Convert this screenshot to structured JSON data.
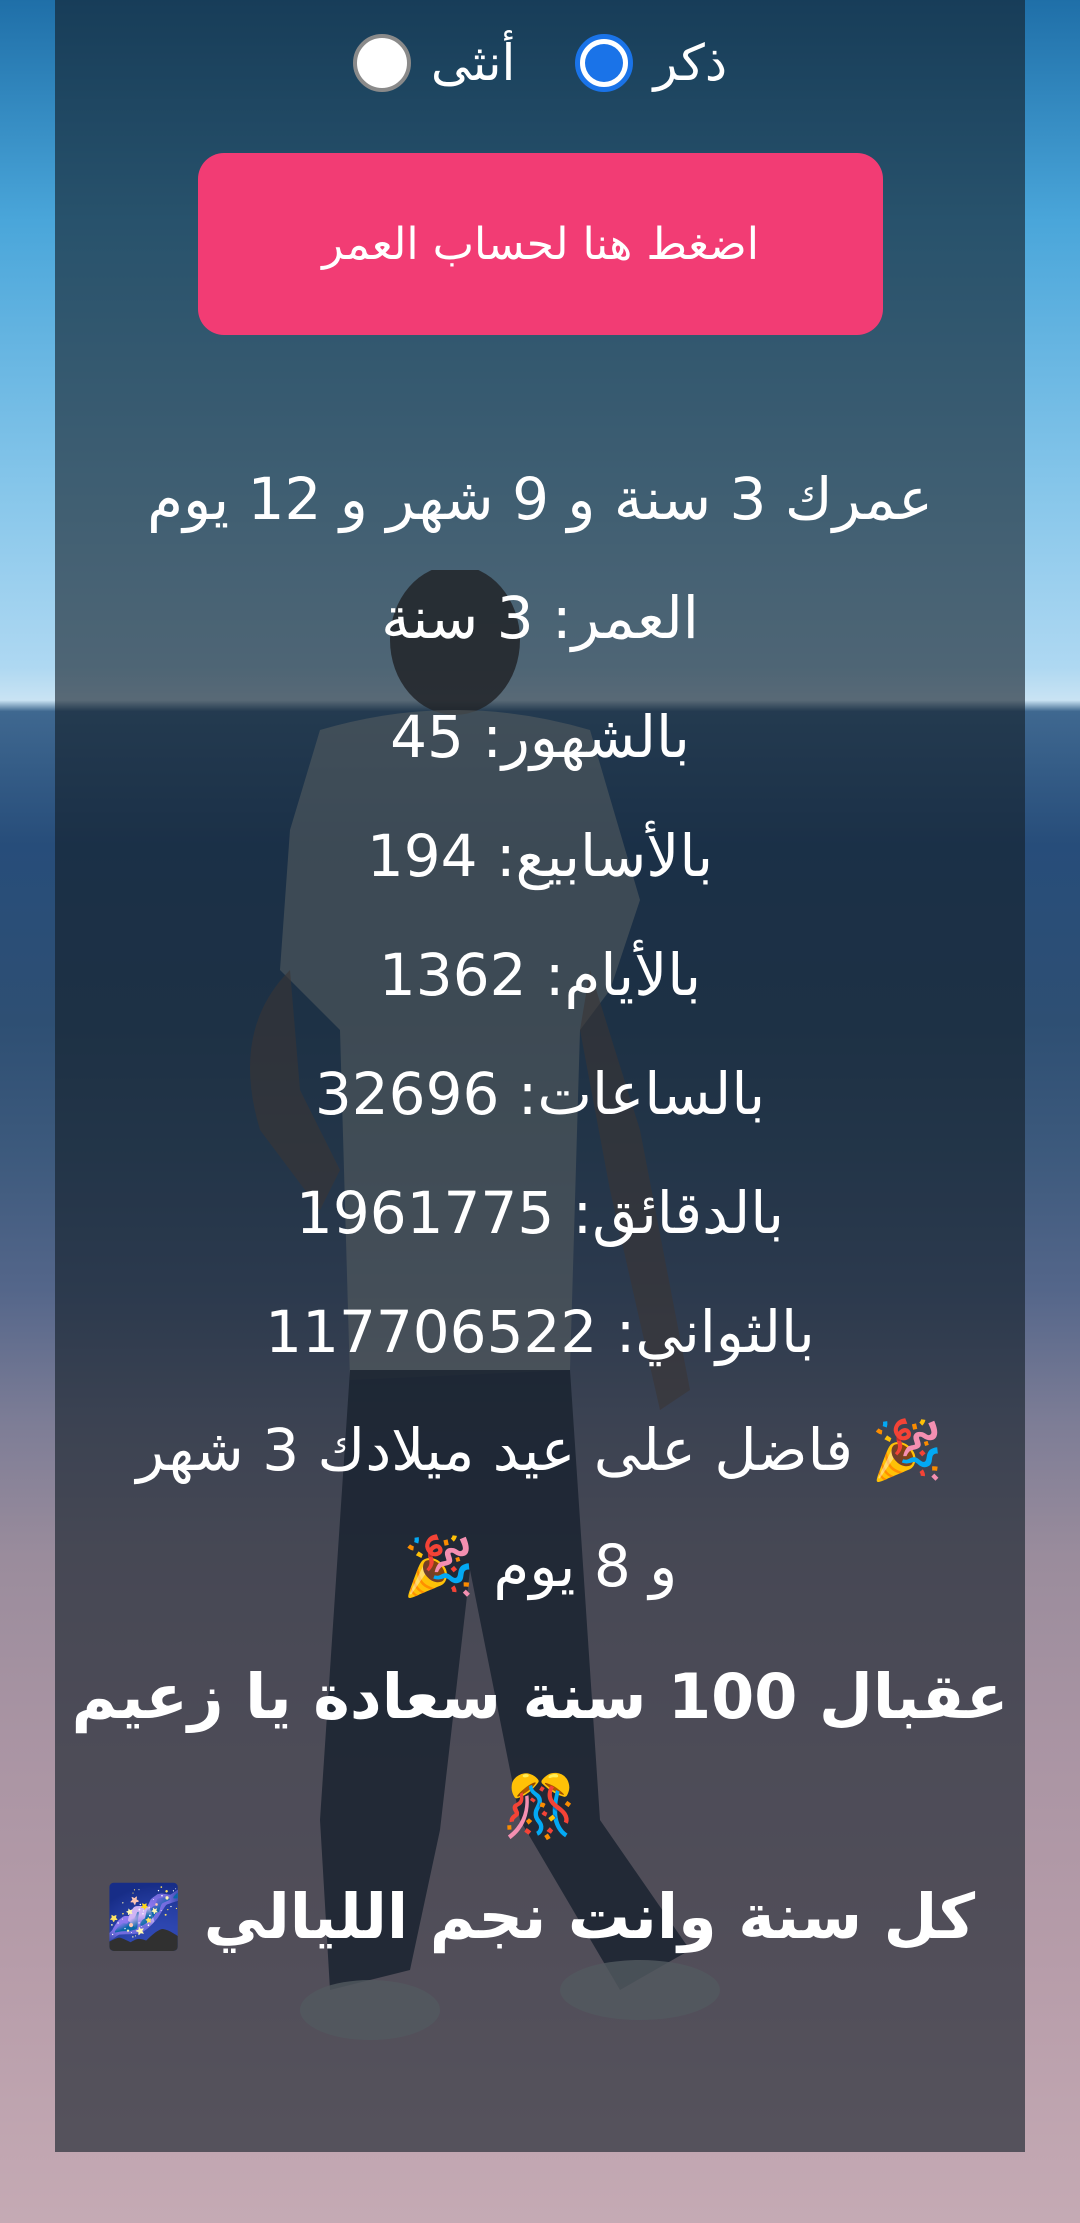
{
  "gender": {
    "options": [
      {
        "label": "ذكر",
        "selected": true
      },
      {
        "label": "أنثى",
        "selected": false
      }
    ]
  },
  "calculate_button": {
    "label": "اضغط هنا لحساب العمر"
  },
  "results": {
    "summary": "عمرك 3 سنة و 9 شهر و 12 يوم",
    "years": "العمر: 3 سنة",
    "months": "بالشهور: 45",
    "weeks": "بالأسابيع: 194",
    "days": "بالأيام: 1362",
    "hours": "بالساعات: 32696",
    "minutes": "بالدقائق: 1961775",
    "seconds": "بالثواني: 117706522",
    "birthday_line1": "🎉 فاضل على عيد ميلادك 3 شهر",
    "birthday_line2": "و 8 يوم 🎉"
  },
  "wishes": {
    "line1": "عقبال 100 سنة سعادة يا زعيم",
    "line2": "🎊",
    "line3": "كل سنة وانت نجم الليالي 🌌"
  },
  "colors": {
    "accent": "#f23c74",
    "radio_selected": "#1a73e8"
  }
}
